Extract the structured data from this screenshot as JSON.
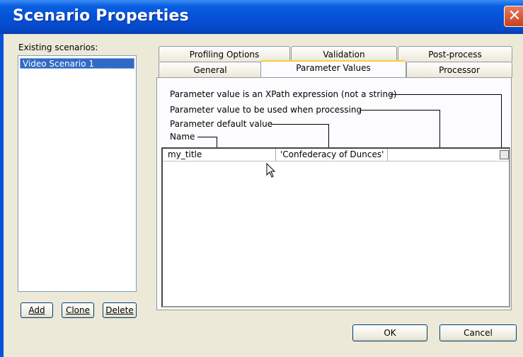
{
  "window": {
    "title": "Scenario Properties",
    "close_glyph": "✕"
  },
  "scenarios": {
    "label": "Existing scenarios:",
    "items": [
      "Video Scenario 1"
    ],
    "add": "Add",
    "clone": "Clone",
    "delete": "Delete"
  },
  "tabs": {
    "row1": [
      "Profiling Options",
      "Validation",
      "Post-process"
    ],
    "row2": [
      "General",
      "Parameter Values",
      "Processor"
    ],
    "active": "Parameter Values"
  },
  "legend": {
    "xpath": "Parameter value is an XPath expression (not a string)",
    "processing": "Parameter value to be used when processing",
    "default": "Parameter default value",
    "name": "Name"
  },
  "grid": {
    "rows": [
      {
        "name": "my_title",
        "default": "'Confederacy of Dunces'",
        "processing": "",
        "xpath": false
      }
    ]
  },
  "footer": {
    "ok": "OK",
    "cancel": "Cancel"
  },
  "colors": {
    "titlebar": "#0551d8",
    "selection": "#316ac5",
    "active_tab_accent": "#ffc83c"
  }
}
